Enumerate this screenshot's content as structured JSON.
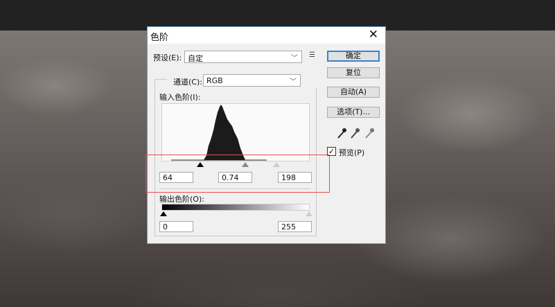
{
  "dialog": {
    "title": "色阶",
    "close_icon": "close-icon"
  },
  "preset": {
    "label": "预设(E):",
    "value": "自定"
  },
  "channel": {
    "label": "通道(C):",
    "value": "RGB"
  },
  "input_levels": {
    "label": "输入色阶(I):",
    "black": "64",
    "gamma": "0.74",
    "white": "198"
  },
  "output_levels": {
    "label": "输出色阶(O):",
    "black": "0",
    "white": "255"
  },
  "buttons": {
    "ok": "确定",
    "reset": "复位",
    "auto": "自动(A)",
    "options": "选项(T)..."
  },
  "preview": {
    "label": "预览(P)",
    "checked": true
  }
}
